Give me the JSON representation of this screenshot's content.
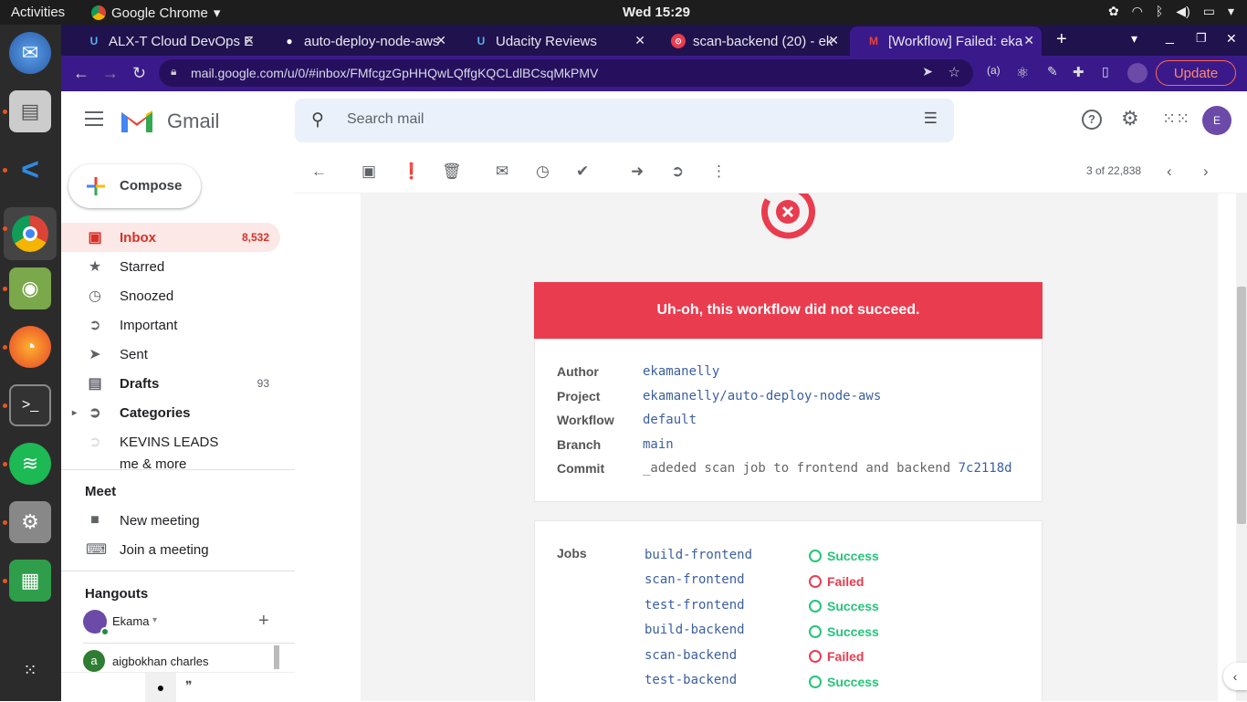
{
  "os": {
    "activities": "Activities",
    "app_name": "Google Chrome",
    "clock": "Wed 15:29"
  },
  "tabs": [
    {
      "title": "ALX-T Cloud DevOps E",
      "icon": "udacity-icon"
    },
    {
      "title": "auto-deploy-node-aws",
      "icon": "github-icon"
    },
    {
      "title": "Udacity Reviews",
      "icon": "udacity-icon"
    },
    {
      "title": "scan-backend (20) - ek",
      "icon": "circleci-icon"
    },
    {
      "title": "[Workflow] Failed: eka",
      "icon": "gmail-icon"
    }
  ],
  "address": {
    "url": "mail.google.com/u/0/#inbox/FMfcgzGpHHQwLQffgKQCLdlBCsqMkPMV",
    "update_label": "Update"
  },
  "gmail": {
    "brand": "Gmail",
    "search_placeholder": "Search mail",
    "avatar_initial": "E"
  },
  "sidebar": {
    "compose_label": "Compose",
    "items": [
      {
        "label": "Inbox",
        "count": "8,532",
        "icon": "inbox-icon"
      },
      {
        "label": "Starred",
        "count": "",
        "icon": "star-icon"
      },
      {
        "label": "Snoozed",
        "count": "",
        "icon": "clock-icon"
      },
      {
        "label": "Important",
        "count": "",
        "icon": "important-icon"
      },
      {
        "label": "Sent",
        "count": "",
        "icon": "send-icon"
      },
      {
        "label": "Drafts",
        "count": "93",
        "icon": "draft-icon"
      },
      {
        "label": "Categories",
        "count": "",
        "icon": "label-icon"
      },
      {
        "label": "KEVINS LEADS",
        "count": "",
        "icon": "label-icon"
      },
      {
        "label": "me & more",
        "count": "",
        "icon": "label-icon"
      }
    ],
    "meet_title": "Meet",
    "new_meeting": "New meeting",
    "join_meeting": "Join a meeting",
    "hangouts_title": "Hangouts",
    "hangouts_user": "Ekama",
    "contact_initial": "a",
    "contact": "aigbokhan charles"
  },
  "toolbar": {
    "pager": "3 of 22,838"
  },
  "email": {
    "banner": "Uh-oh, this workflow did not succeed.",
    "details": [
      {
        "key": "Author",
        "value": "ekamanelly"
      },
      {
        "key": "Project",
        "value": "ekamanelly/auto-deploy-node-aws"
      },
      {
        "key": "Workflow",
        "value": "default"
      },
      {
        "key": "Branch",
        "value": "main"
      },
      {
        "key": "Commit",
        "value": "_adeded scan job to frontend and backend",
        "hash": "7c2118d"
      }
    ],
    "jobs_label": "Jobs",
    "jobs": [
      {
        "name": "build-frontend",
        "status": "Success",
        "ok": true
      },
      {
        "name": "scan-frontend",
        "status": "Failed",
        "ok": false
      },
      {
        "name": "test-frontend",
        "status": "Success",
        "ok": true
      },
      {
        "name": "build-backend",
        "status": "Success",
        "ok": true
      },
      {
        "name": "scan-backend",
        "status": "Failed",
        "ok": false
      },
      {
        "name": "test-backend",
        "status": "Success",
        "ok": true
      }
    ]
  },
  "colors": {
    "brand_purple": "#3a1a8a",
    "fail_red": "#e93c4f",
    "success_green": "#25c47a",
    "link_blue": "#3b5fa0"
  }
}
